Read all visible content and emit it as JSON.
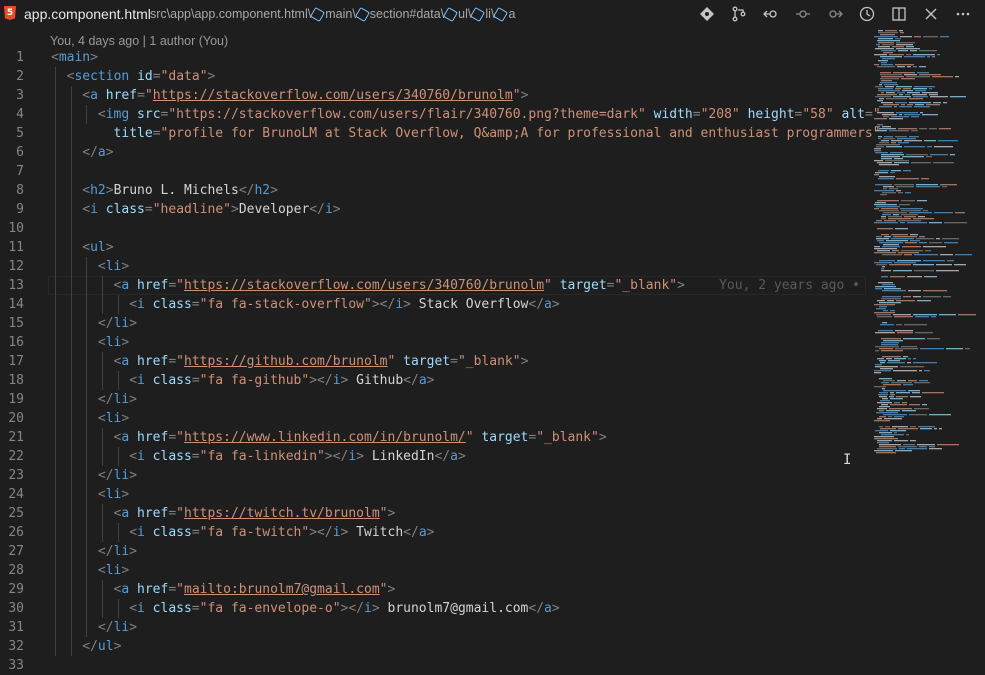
{
  "tab": {
    "file_name": "app.component.html",
    "icon": "html5-icon"
  },
  "breadcrumb": [
    "src\\app\\app.component.html",
    "main",
    "section#data",
    "ul",
    "li",
    "a"
  ],
  "blame_header": "You, 4 days ago | 1 author (You)",
  "inline_blame": "You, 2 years ago •",
  "toolbar": [
    "git-compare-icon",
    "source-control-icon",
    "go-back-icon",
    "go-circle-icon",
    "go-forward-icon",
    "timeline-icon",
    "split-editor-icon",
    "close-icon",
    "more-icon"
  ],
  "lines": [
    {
      "n": "1"
    },
    {
      "n": "2"
    },
    {
      "n": "3"
    },
    {
      "n": "4"
    },
    {
      "n": "5"
    },
    {
      "n": "6"
    },
    {
      "n": "7"
    },
    {
      "n": "8"
    },
    {
      "n": "9"
    },
    {
      "n": "10"
    },
    {
      "n": "11"
    },
    {
      "n": "12"
    },
    {
      "n": "13"
    },
    {
      "n": "14"
    },
    {
      "n": "15"
    },
    {
      "n": "16"
    },
    {
      "n": "17"
    },
    {
      "n": "18"
    },
    {
      "n": "19"
    },
    {
      "n": "20"
    },
    {
      "n": "21"
    },
    {
      "n": "22"
    },
    {
      "n": "23"
    },
    {
      "n": "24"
    },
    {
      "n": "25"
    },
    {
      "n": "26"
    },
    {
      "n": "27"
    },
    {
      "n": "28"
    },
    {
      "n": "29"
    },
    {
      "n": "30"
    },
    {
      "n": "31"
    },
    {
      "n": "32"
    },
    {
      "n": "33"
    }
  ],
  "code": {
    "l1": [
      "<",
      "main",
      ">"
    ],
    "l2": [
      "<",
      "section",
      "id",
      "=",
      "\"data\"",
      ">"
    ],
    "l3": [
      "<",
      "a",
      "href",
      "=",
      "\"",
      "https://stackoverflow.com/users/340760/brunolm",
      "\"",
      ">"
    ],
    "l4": [
      "<",
      "img",
      "src",
      "=",
      "\"https://stackoverflow.com/users/flair/340760.png?theme=dark\"",
      "width",
      "=",
      "\"208\"",
      "height",
      "=",
      "\"58\"",
      "alt",
      "=",
      "\""
    ],
    "l5": [
      "title",
      "=",
      "\"profile for BrunoLM at Stack Overflow, Q&amp;A for professional and enthusiast programmers\""
    ],
    "l6": [
      "</",
      "a",
      ">"
    ],
    "l8": [
      "<",
      "h2",
      ">",
      "Bruno L. Michels",
      "</",
      "h2",
      ">"
    ],
    "l9": [
      "<",
      "i",
      "class",
      "=",
      "\"headline\"",
      ">",
      "Developer",
      "</",
      "i",
      ">"
    ],
    "l11": [
      "<",
      "ul",
      ">"
    ],
    "l12": [
      "<",
      "li",
      ">"
    ],
    "l13": [
      "<",
      "a",
      "href",
      "=",
      "\"",
      "https://stackoverflow.com/users/340760/brunolm",
      "\"",
      "target",
      "=",
      "\"_blank\"",
      ">"
    ],
    "l14": [
      "<",
      "i",
      "class",
      "=",
      "\"fa fa-stack-overflow\"",
      "></",
      "i",
      ">",
      " Stack Overflow",
      "</",
      "a",
      ">"
    ],
    "l15": [
      "</",
      "li",
      ">"
    ],
    "l16": [
      "<",
      "li",
      ">"
    ],
    "l17": [
      "<",
      "a",
      "href",
      "=",
      "\"",
      "https://github.com/brunolm",
      "\"",
      "target",
      "=",
      "\"_blank\"",
      ">"
    ],
    "l18": [
      "<",
      "i",
      "class",
      "=",
      "\"fa fa-github\"",
      "></",
      "i",
      ">",
      " Github",
      "</",
      "a",
      ">"
    ],
    "l19": [
      "</",
      "li",
      ">"
    ],
    "l20": [
      "<",
      "li",
      ">"
    ],
    "l21": [
      "<",
      "a",
      "href",
      "=",
      "\"",
      "https://www.linkedin.com/in/brunolm/",
      "\"",
      "target",
      "=",
      "\"_blank\"",
      ">"
    ],
    "l22": [
      "<",
      "i",
      "class",
      "=",
      "\"fa fa-linkedin\"",
      "></",
      "i",
      ">",
      " LinkedIn",
      "</",
      "a",
      ">"
    ],
    "l23": [
      "</",
      "li",
      ">"
    ],
    "l24": [
      "<",
      "li",
      ">"
    ],
    "l25": [
      "<",
      "a",
      "href",
      "=",
      "\"",
      "https://twitch.tv/brunolm",
      "\"",
      ">"
    ],
    "l26": [
      "<",
      "i",
      "class",
      "=",
      "\"fa fa-twitch\"",
      "></",
      "i",
      ">",
      " Twitch",
      "</",
      "a",
      ">"
    ],
    "l27": [
      "</",
      "li",
      ">"
    ],
    "l28": [
      "<",
      "li",
      ">"
    ],
    "l29": [
      "<",
      "a",
      "href",
      "=",
      "\"",
      "mailto:brunolm7@gmail.com",
      "\"",
      ">"
    ],
    "l30": [
      "<",
      "i",
      "class",
      "=",
      "\"fa fa-envelope-o\"",
      "></",
      "i",
      ">",
      " brunolm7@gmail.com",
      "</",
      "a",
      ">"
    ],
    "l31": [
      "</",
      "li",
      ">"
    ],
    "l32": [
      "</",
      "ul",
      ">"
    ]
  },
  "colors": {
    "tag": "#569cd6",
    "attr": "#9cdcfe",
    "string": "#ce9178",
    "punct": "#808080",
    "text": "#d4d4d4",
    "bg": "#1e1e1e"
  }
}
